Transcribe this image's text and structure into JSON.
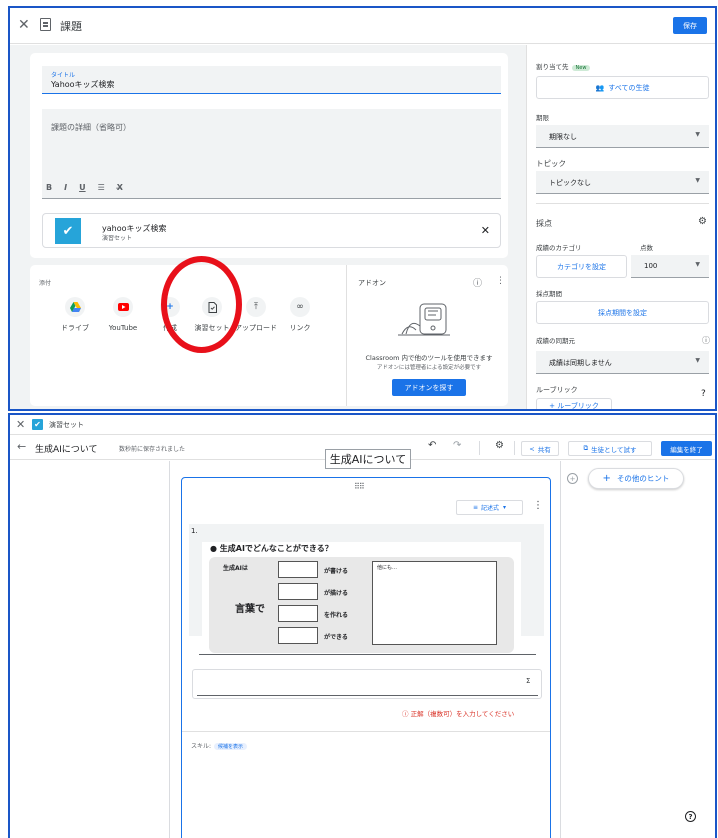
{
  "assignment": {
    "header_title": "課題",
    "save_label": "保存",
    "title_label": "タイトル",
    "title_value": "Yahooキッズ検索",
    "details_placeholder": "課題の詳細（省略可）",
    "format_icons": [
      "B",
      "I",
      "U",
      "☰",
      "X̶"
    ],
    "attachment": {
      "title": "yahooキッズ検索",
      "subtitle": "演習セット"
    },
    "attach_section_label": "添付",
    "tools": [
      {
        "label": "ドライブ",
        "icon": "drive-icon",
        "color": "#fbbc04"
      },
      {
        "label": "YouTube",
        "icon": "youtube-icon",
        "color": "#ff0000"
      },
      {
        "label": "作成",
        "icon": "create-icon",
        "color": "#1a73e8"
      },
      {
        "label": "演習セット",
        "icon": "practice-set-icon",
        "color": "#3c4043"
      },
      {
        "label": "アップロード",
        "icon": "upload-icon",
        "color": "#3c4043"
      },
      {
        "label": "リンク",
        "icon": "link-icon",
        "color": "#3c4043"
      }
    ],
    "addons": {
      "title": "アドオン",
      "description": "Classroom 内で他のツールを使用できます",
      "sub": "アドオンには管理者による設定が必要です",
      "button": "アドオンを探す"
    },
    "sidebar": {
      "assign_to_label": "割り当て先",
      "new_badge": "New",
      "all_students": "すべての生徒",
      "due_label": "期限",
      "due_value": "期限なし",
      "topic_label": "トピック",
      "topic_value": "トピックなし",
      "grading_label": "採点",
      "grade_category_label": "成績のカテゴリ",
      "points_label": "点数",
      "set_category": "カテゴリを設定",
      "points_value": "100",
      "grading_period_label": "採点期間",
      "set_grading_period": "採点期間を設定",
      "grade_sync_label": "成績の同期元",
      "grade_sync_value": "成績は同期しません",
      "rubric_label": "ルーブリック",
      "rubric_button": "+ ルーブリック"
    }
  },
  "practice_set": {
    "window_title": "演習セット",
    "doc_title": "生成AIについて",
    "saved_status": "数秒前に保存されました",
    "share_label": "共有",
    "try_as_student": "生徒として試す",
    "finish_editing": "編集を終了",
    "heading": "生成AIについて",
    "question_type": "記述式",
    "question_number": "1.",
    "image": {
      "title": "● 生成AIでどんなことができる？",
      "ai_wa": "生成AIは",
      "kotoba_de": "言葉で",
      "rows": [
        "が書ける",
        "が描ける",
        "を作れる",
        "ができる"
      ],
      "other": "他にも…"
    },
    "sigma": "Σ",
    "error": "正解（複数可）を入力してください",
    "skill_label": "スキル:",
    "skill_tag": "候補を表示",
    "hint_button": "その他のヒント"
  },
  "colors": {
    "accent": "#1a73e8",
    "highlight_ring": "#e8101a"
  }
}
